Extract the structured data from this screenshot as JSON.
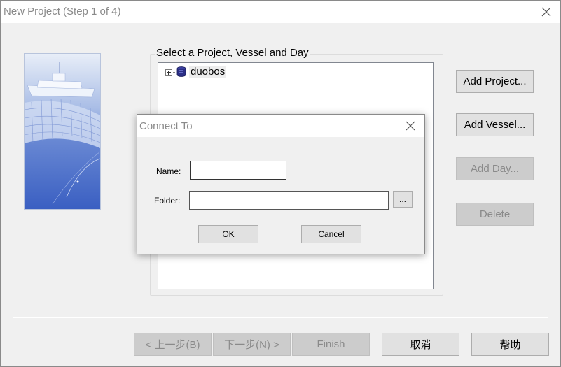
{
  "window": {
    "title": "New Project (Step 1 of 4)",
    "close_icon": "close-icon"
  },
  "group": {
    "label": "Select a Project, Vessel and Day"
  },
  "tree": {
    "items": [
      {
        "label": "duobos",
        "icon": "database-icon",
        "expander": "+"
      }
    ]
  },
  "side_buttons": {
    "add_project": "Add Project...",
    "add_vessel": "Add Vessel...",
    "add_day": "Add Day...",
    "delete": "Delete"
  },
  "footer_buttons": {
    "back": "< 上一步(B)",
    "next": "下一步(N) >",
    "finish": "Finish",
    "cancel": "取消",
    "help": "帮助"
  },
  "dialog": {
    "title": "Connect To",
    "name_label": "Name:",
    "name_value": "",
    "folder_label": "Folder:",
    "folder_value": "",
    "browse": "...",
    "ok": "OK",
    "cancel": "Cancel"
  },
  "colors": {
    "window_bg": "#f0f0f0",
    "disabled_text": "#8a8a8a",
    "button_bg": "#e1e1e1"
  }
}
